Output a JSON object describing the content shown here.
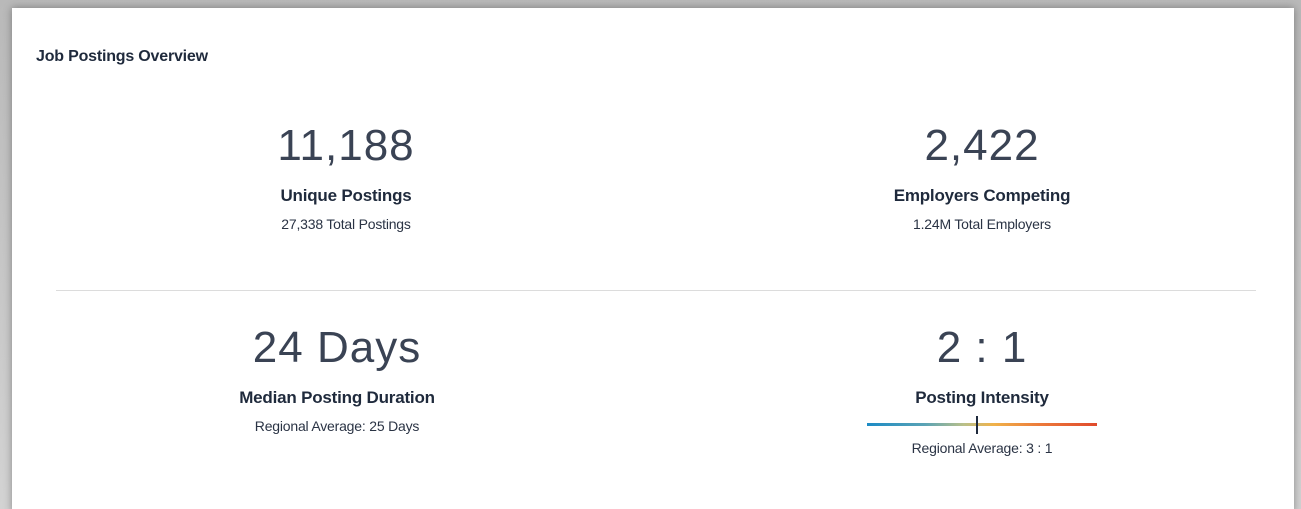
{
  "card": {
    "title": "Job Postings Overview"
  },
  "metrics": [
    {
      "value": "11,188",
      "label": "Unique Postings",
      "sub": "27,338 Total Postings"
    },
    {
      "value": "2,422",
      "label": "Employers Competing",
      "sub": "1.24M Total Employers"
    },
    {
      "value": "24 Days",
      "label": "Median Posting Duration",
      "sub": "Regional Average: 25 Days"
    },
    {
      "value": "2 : 1",
      "label": "Posting Intensity",
      "sub": "Regional Average: 3 : 1",
      "gauge": {
        "level_fraction": 0.48,
        "gradient_colors": [
          "#1c8bc5",
          "#f0b24a",
          "#e04a2c"
        ]
      }
    }
  ]
}
